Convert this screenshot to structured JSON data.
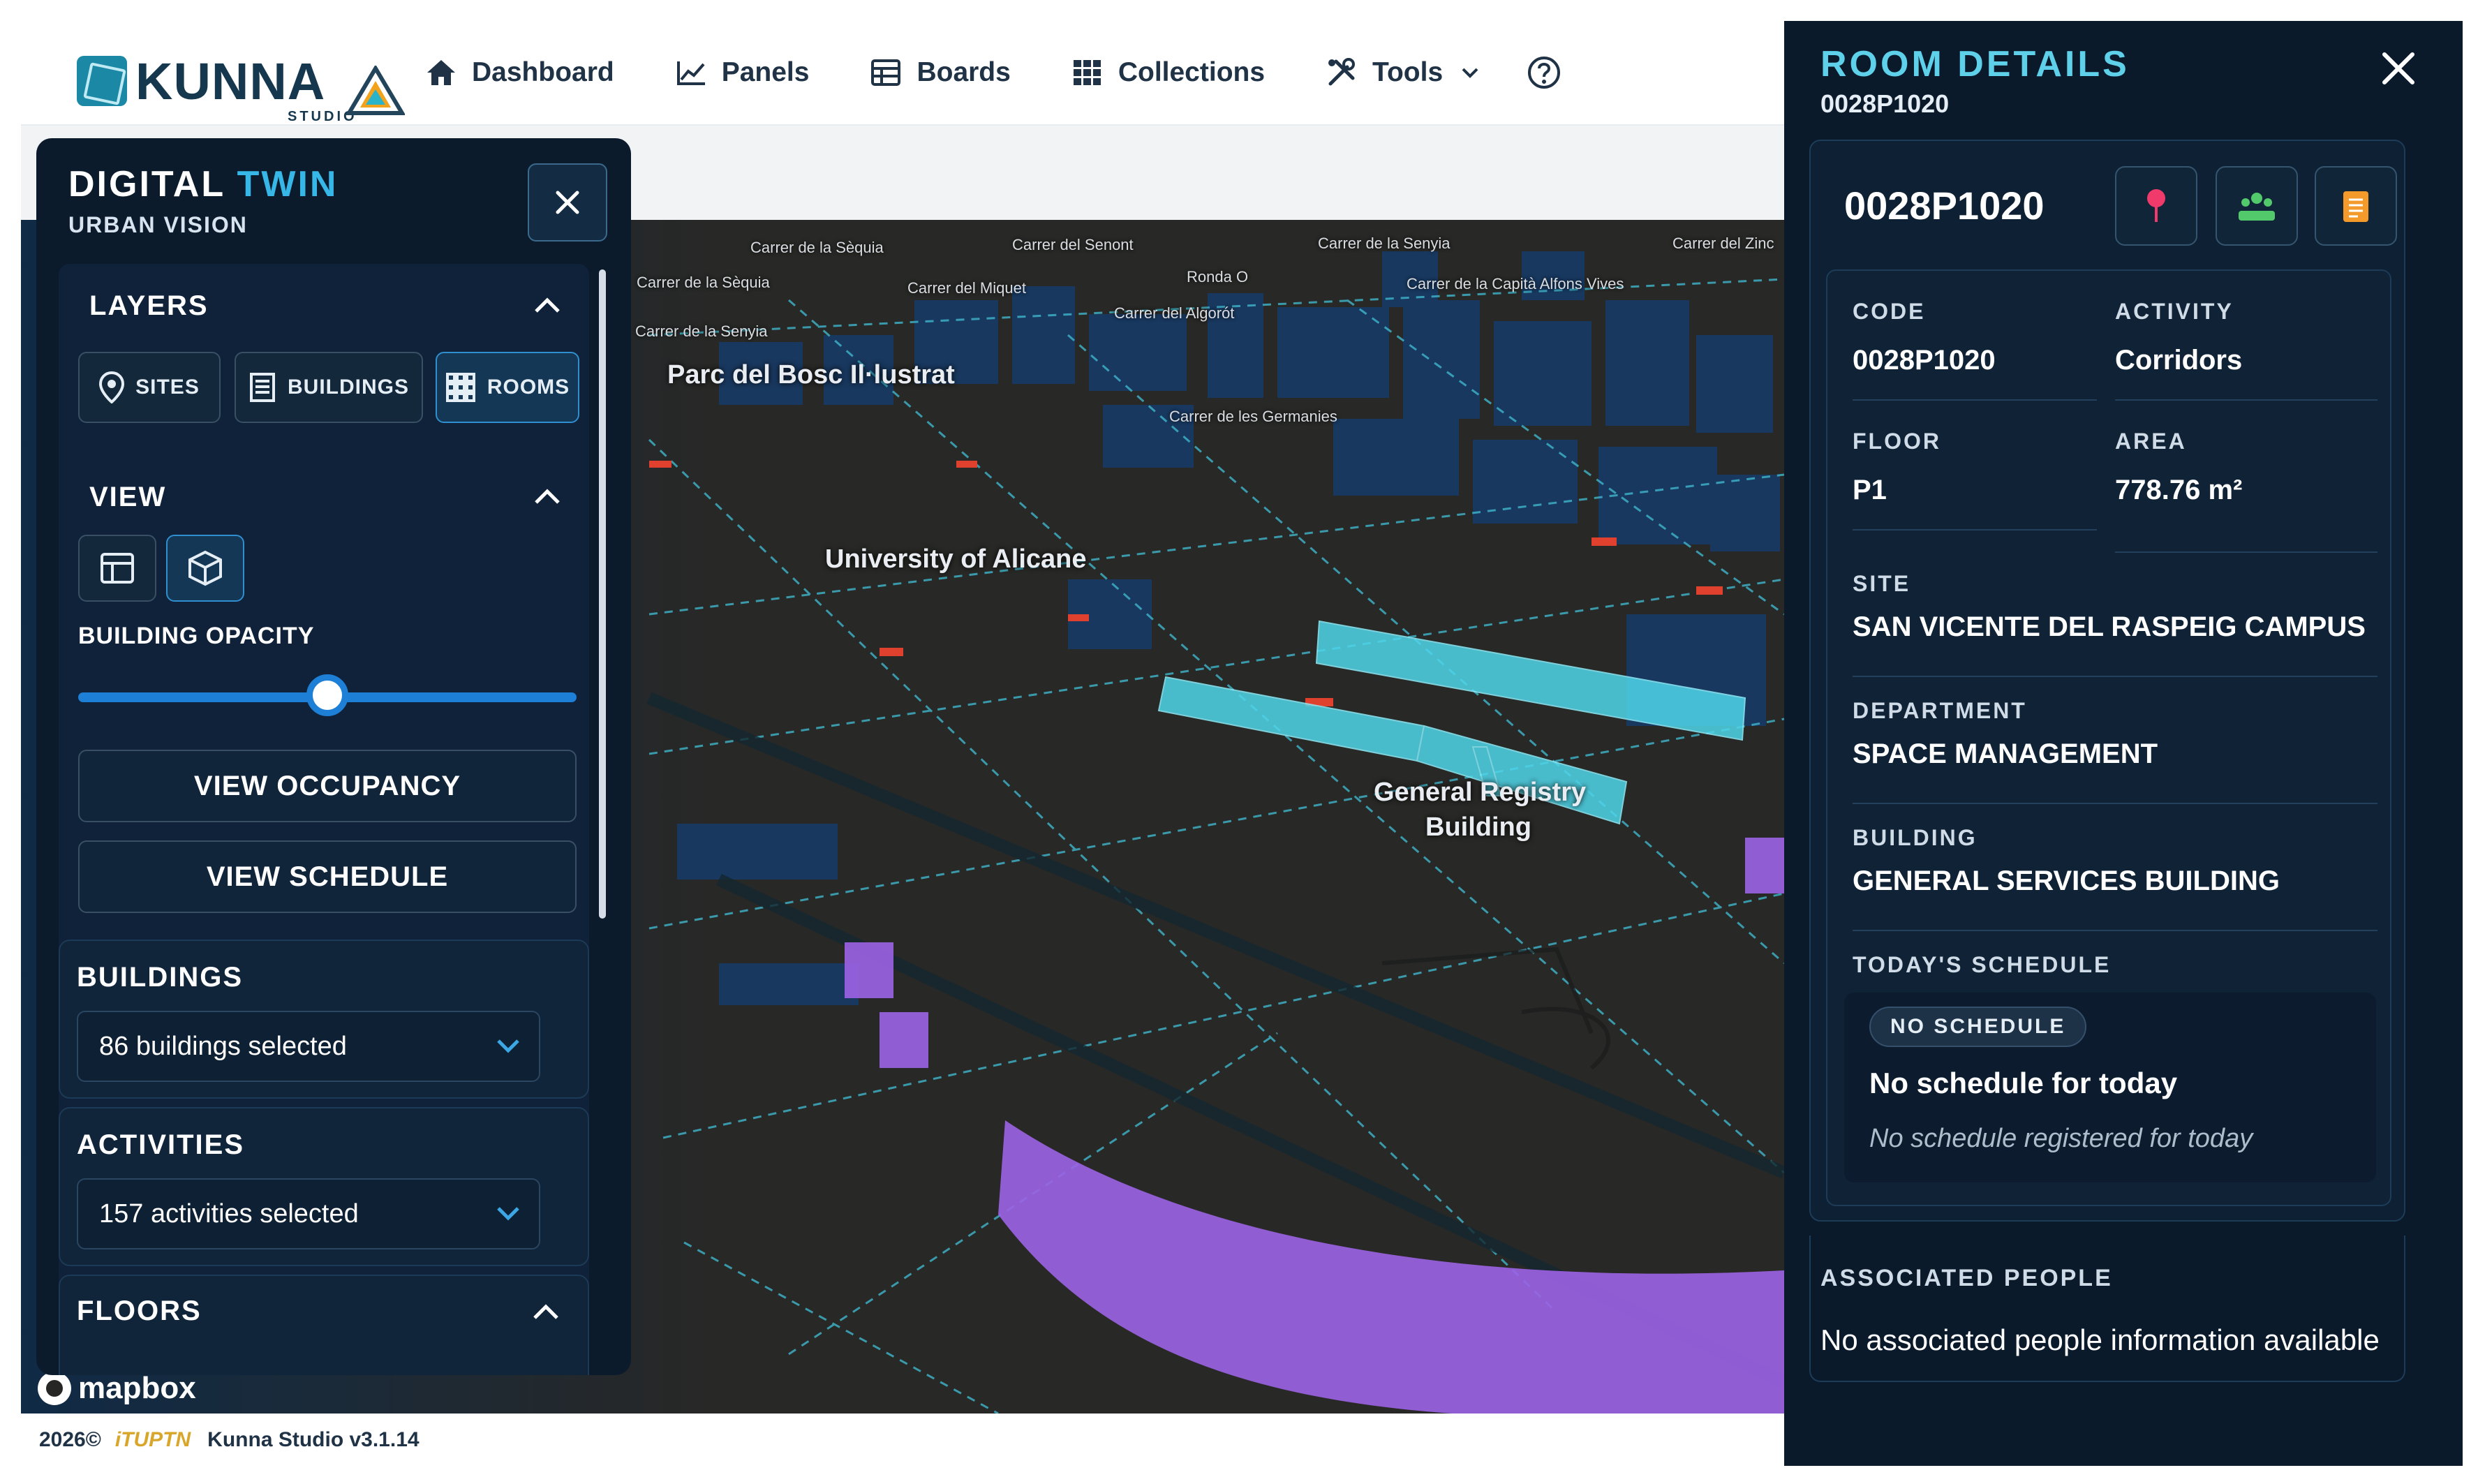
{
  "nav": {
    "logo_word": "KUNNA",
    "logo_sub": "STUDIO",
    "items": [
      {
        "label": "Dashboard",
        "icon": "home-icon"
      },
      {
        "label": "Panels",
        "icon": "line-chart-icon"
      },
      {
        "label": "Boards",
        "icon": "table-icon"
      },
      {
        "label": "Collections",
        "icon": "grid-icon"
      },
      {
        "label": "Tools",
        "icon": "tools-icon"
      }
    ],
    "help_icon": "help-circle-icon"
  },
  "left_panel": {
    "title_main": "DIGITAL",
    "title_accent": "TWIN",
    "subtitle": "URBAN VISION",
    "layers": {
      "header": "LAYERS",
      "chips": [
        "SITES",
        "BUILDINGS",
        "ROOMS"
      ],
      "active": "ROOMS"
    },
    "view": {
      "header": "VIEW",
      "modes": [
        "2d-map-icon",
        "3d-cube-icon"
      ],
      "active": "3d-cube-icon"
    },
    "opacity": {
      "label": "BUILDING OPACITY",
      "value_fraction": 0.5
    },
    "buttons": {
      "occupancy": "VIEW OCCUPANCY",
      "schedule": "VIEW SCHEDULE"
    },
    "buildings": {
      "header": "BUILDINGS",
      "value": "86 buildings selected"
    },
    "activities": {
      "header": "ACTIVITIES",
      "value": "157 activities selected"
    },
    "floors": {
      "header": "FLOORS"
    }
  },
  "map": {
    "labels": {
      "park": "Parc del Bosc Il·lustrat",
      "university": "University of Alicane",
      "registry_1": "General Registry",
      "registry_2": "Building"
    },
    "streets": [
      "Carrer de la Sèquia",
      "Carrer del Senont",
      "Carrer de la Senyia",
      "Carrer del Zinc",
      "Carrer de la Sèquia",
      "Carrer del Miquet",
      "Ronda O",
      "Carrer de la Capità Alfons Vives",
      "Carrer del Algorót",
      "Carrer de la Senyia",
      "Carrer de les Germanies"
    ],
    "attribution": "mapbox"
  },
  "footer": {
    "year": "2026©",
    "brand": "iTUPTN",
    "version": "Kunna Studio v3.1.14"
  },
  "room_details": {
    "title": "ROOM DETAILS",
    "code_top": "0028P1020",
    "card_code": "0028P1020",
    "actions": [
      "location-pin-icon",
      "people-icon",
      "clipboard-icon"
    ],
    "fields": {
      "code_label": "CODE",
      "code": "0028P1020",
      "activity_label": "ACTIVITY",
      "activity": "Corridors",
      "floor_label": "FLOOR",
      "floor": "P1",
      "area_label": "AREA",
      "area": "778.76 m²",
      "site_label": "SITE",
      "site": "SAN VICENTE DEL RASPEIG CAMPUS",
      "department_label": "DEPARTMENT",
      "department": "SPACE MANAGEMENT",
      "building_label": "BUILDING",
      "building": "GENERAL SERVICES BUILDING"
    },
    "schedule": {
      "label": "TODAY'S SCHEDULE",
      "badge": "NO SCHEDULE",
      "heading": "No schedule for today",
      "note": "No schedule registered for today"
    },
    "associated": {
      "label": "ASSOCIATED PEOPLE",
      "text": "No associated people information available"
    }
  },
  "colors": {
    "accent": "#36b7e8",
    "panel": "#0c1b2c",
    "highlight": "#4fd6ea",
    "purple": "#b06ae8"
  }
}
